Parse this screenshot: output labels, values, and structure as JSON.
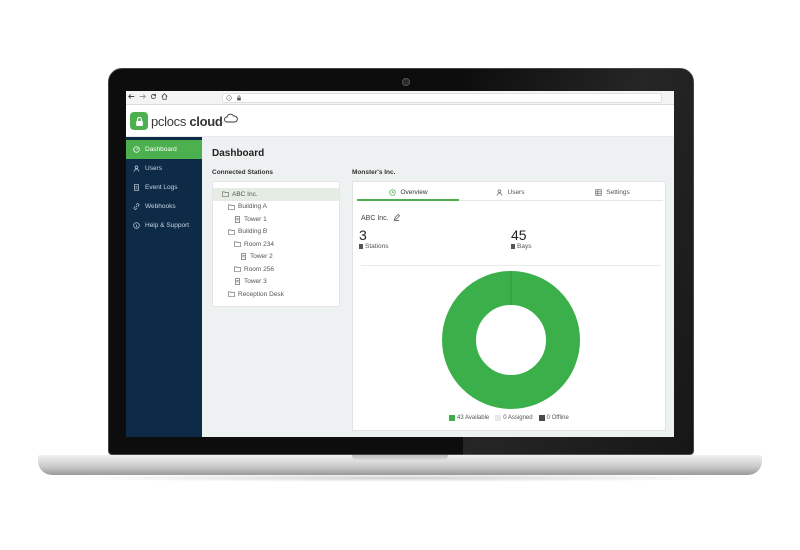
{
  "browser": {
    "back_icon": "arrow-left-icon",
    "forward_icon": "arrow-right-icon",
    "refresh_icon": "refresh-icon",
    "home_icon": "home-icon"
  },
  "app": {
    "logo_prefix": "pclocs",
    "logo_suffix": "cloud",
    "brand_color": "#4cb04f",
    "sidebar_color": "#0d2a47"
  },
  "sidebar": {
    "items": [
      {
        "label": "Dashboard",
        "icon": "dashboard-icon"
      },
      {
        "label": "Users",
        "icon": "user-icon"
      },
      {
        "label": "Event Logs",
        "icon": "document-icon"
      },
      {
        "label": "Webhooks",
        "icon": "link-icon"
      },
      {
        "label": "Help & Support",
        "icon": "help-icon"
      }
    ]
  },
  "main": {
    "title": "Dashboard",
    "connected_label": "Connected Stations",
    "detail_label": "Monster's Inc."
  },
  "tree": [
    {
      "label": "ABC Inc.",
      "kind": "folder"
    },
    {
      "label": "Building A",
      "kind": "folder"
    },
    {
      "label": "Tower 1",
      "kind": "station"
    },
    {
      "label": "Building B",
      "kind": "folder"
    },
    {
      "label": "Room 234",
      "kind": "folder"
    },
    {
      "label": "Tower 2",
      "kind": "station"
    },
    {
      "label": "Room 256",
      "kind": "folder"
    },
    {
      "label": "Tower 3",
      "kind": "station"
    },
    {
      "label": "Reception Desk",
      "kind": "folder"
    }
  ],
  "tabs": [
    {
      "label": "Overview",
      "icon": "clock-icon"
    },
    {
      "label": "Users",
      "icon": "user-icon"
    },
    {
      "label": "Settings",
      "icon": "settings-grid-icon"
    }
  ],
  "overview": {
    "org_name": "ABC Inc.",
    "stations_count": "3",
    "stations_label": "Stations",
    "bays_count": "45",
    "bays_label": "Bays"
  },
  "legend": [
    {
      "label": "43 Available",
      "color": "#3bb04a"
    },
    {
      "label": "0 Assigned",
      "color": "#e8e8e8"
    },
    {
      "label": "0 Offline",
      "color": "#4a4a4a"
    }
  ],
  "chart_data": {
    "type": "pie",
    "categories": [
      "Available",
      "Assigned",
      "Offline"
    ],
    "values": [
      43,
      0,
      0
    ],
    "title": ""
  }
}
